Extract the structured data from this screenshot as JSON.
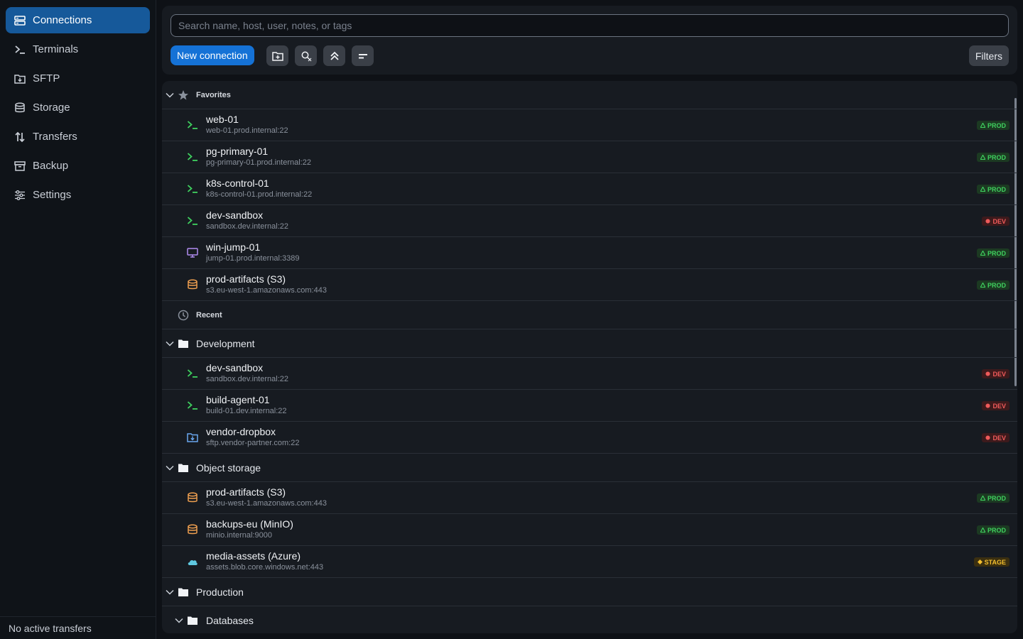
{
  "sidebar": {
    "items": [
      {
        "label": "Connections",
        "icon": "connections-icon"
      },
      {
        "label": "Terminals",
        "icon": "terminal-icon"
      },
      {
        "label": "SFTP",
        "icon": "sftp-folder-icon"
      },
      {
        "label": "Storage",
        "icon": "database-icon"
      },
      {
        "label": "Transfers",
        "icon": "transfer-arrows-icon"
      },
      {
        "label": "Backup",
        "icon": "archive-box-icon"
      },
      {
        "label": "Settings",
        "icon": "sliders-icon"
      }
    ],
    "footer": "No active transfers"
  },
  "toolbar": {
    "search_placeholder": "Search name, host, user, notes, or tags",
    "new_connection_label": "New connection",
    "filters_label": "Filters"
  },
  "colors": {
    "accent": "#1572d6",
    "active_nav": "#16599a",
    "prod": "#3fd15f",
    "dev": "#ef5a5a",
    "stage": "#f4bf2e",
    "ssh_icon": "#3fd15f",
    "rdp_icon": "#b08cf0",
    "storage_icon": "#f0a050",
    "azure_icon": "#5fc8e0"
  },
  "sections": {
    "favorites": {
      "label": "Favorites",
      "rows": [
        {
          "name": "web-01",
          "host": "web-01.prod.internal:22",
          "icon": "terminal-prompt-icon",
          "badge": "PROD"
        },
        {
          "name": "pg-primary-01",
          "host": "pg-primary-01.prod.internal:22",
          "icon": "terminal-prompt-icon",
          "badge": "PROD"
        },
        {
          "name": "k8s-control-01",
          "host": "k8s-control-01.prod.internal:22",
          "icon": "terminal-prompt-icon",
          "badge": "PROD"
        },
        {
          "name": "dev-sandbox",
          "host": "sandbox.dev.internal:22",
          "icon": "terminal-prompt-icon",
          "badge": "DEV"
        },
        {
          "name": "win-jump-01",
          "host": "jump-01.prod.internal:3389",
          "icon": "monitor-icon",
          "badge": "PROD"
        },
        {
          "name": "prod-artifacts (S3)",
          "host": "s3.eu-west-1.amazonaws.com:443",
          "icon": "database-icon",
          "badge": "PROD"
        }
      ]
    },
    "recent": {
      "label": "Recent"
    },
    "development": {
      "label": "Development",
      "rows": [
        {
          "name": "dev-sandbox",
          "host": "sandbox.dev.internal:22",
          "icon": "terminal-prompt-icon",
          "badge": "DEV"
        },
        {
          "name": "build-agent-01",
          "host": "build-01.dev.internal:22",
          "icon": "terminal-prompt-icon",
          "badge": "DEV"
        },
        {
          "name": "vendor-dropbox",
          "host": "sftp.vendor-partner.com:22",
          "icon": "sftp-folder-icon",
          "badge": "DEV"
        }
      ]
    },
    "object_storage": {
      "label": "Object storage",
      "rows": [
        {
          "name": "prod-artifacts (S3)",
          "host": "s3.eu-west-1.amazonaws.com:443",
          "icon": "database-icon",
          "badge": "PROD"
        },
        {
          "name": "backups-eu (MinIO)",
          "host": "minio.internal:9000",
          "icon": "database-icon",
          "badge": "PROD"
        },
        {
          "name": "media-assets (Azure)",
          "host": "assets.blob.core.windows.net:443",
          "icon": "cloud-icon",
          "badge": "STAGE"
        }
      ]
    },
    "production": {
      "label": "Production",
      "sub": {
        "label": "Databases"
      }
    }
  }
}
